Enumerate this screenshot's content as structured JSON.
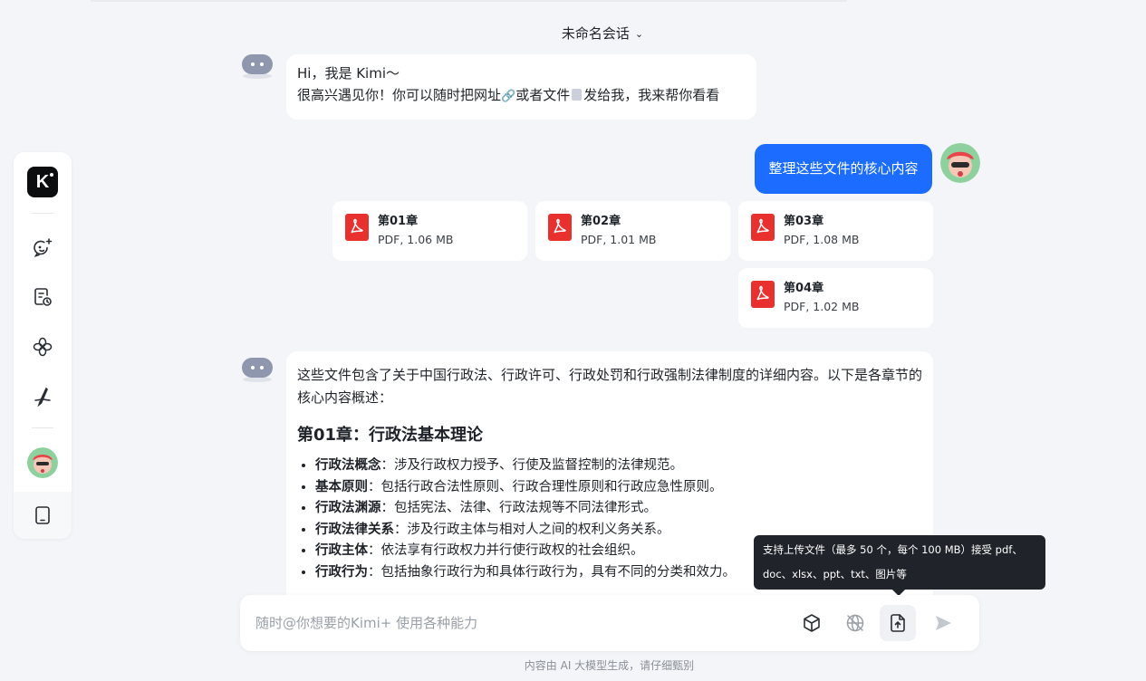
{
  "chat": {
    "title": "未命名会话"
  },
  "greeting": {
    "line1": "Hi，我是 Kimi～",
    "line2_a": "很高兴遇见你！你可以随时把网址",
    "line2_b": "或者文件",
    "line2_c": "发给我，我来帮你看看"
  },
  "user_message": {
    "text": "整理这些文件的核心内容"
  },
  "files": [
    {
      "name": "第01章",
      "meta": "PDF, 1.06 MB"
    },
    {
      "name": "第02章",
      "meta": "PDF, 1.01 MB"
    },
    {
      "name": "第03章",
      "meta": "PDF, 1.08 MB"
    },
    {
      "name": "第04章",
      "meta": "PDF, 1.02 MB"
    }
  ],
  "answer": {
    "intro": "这些文件包含了关于中国行政法、行政许可、行政处罚和行政强制法律制度的详细内容。以下是各章节的核心内容概述：",
    "heading": "第01章：行政法基本理论",
    "items": [
      {
        "term": "行政法概念",
        "desc": "：涉及行政权力授予、行使及监督控制的法律规范。"
      },
      {
        "term": "基本原则",
        "desc": "：包括行政合法性原则、行政合理性原则和行政应急性原则。"
      },
      {
        "term": "行政法渊源",
        "desc": "：包括宪法、法律、行政法规等不同法律形式。"
      },
      {
        "term": "行政法律关系",
        "desc": "：涉及行政主体与相对人之间的权利义务关系。"
      },
      {
        "term": "行政主体",
        "desc": "：依法享有行政权力并行使行政权的社会组织。"
      },
      {
        "term": "行政行为",
        "desc": "：包括抽象行政行为和具体行政行为，具有不同的分类和效力。"
      }
    ]
  },
  "tooltip": {
    "line1": "支持上传文件（最多 50 个，每个 100 MB）接受 pdf、",
    "line2": "doc、xlsx、ppt、txt、图片等"
  },
  "composer": {
    "placeholder": "随时@你想要的Kimi+ 使用各种能力"
  },
  "footer": {
    "note": "内容由 AI 大模型生成，请仔细甄别"
  },
  "icons": {
    "sidebar": [
      "kimi-logo-icon",
      "new-chat-icon",
      "history-icon",
      "kimi-plus-icon",
      "pen-icon",
      "user-avatar",
      "tablet-icon"
    ],
    "composer": [
      "cube-icon",
      "web-search-off-icon",
      "upload-file-icon",
      "send-icon"
    ]
  },
  "colors": {
    "accent": "#1b6cff",
    "pdf": "#e8312f",
    "tooltip_bg": "#20232a"
  }
}
